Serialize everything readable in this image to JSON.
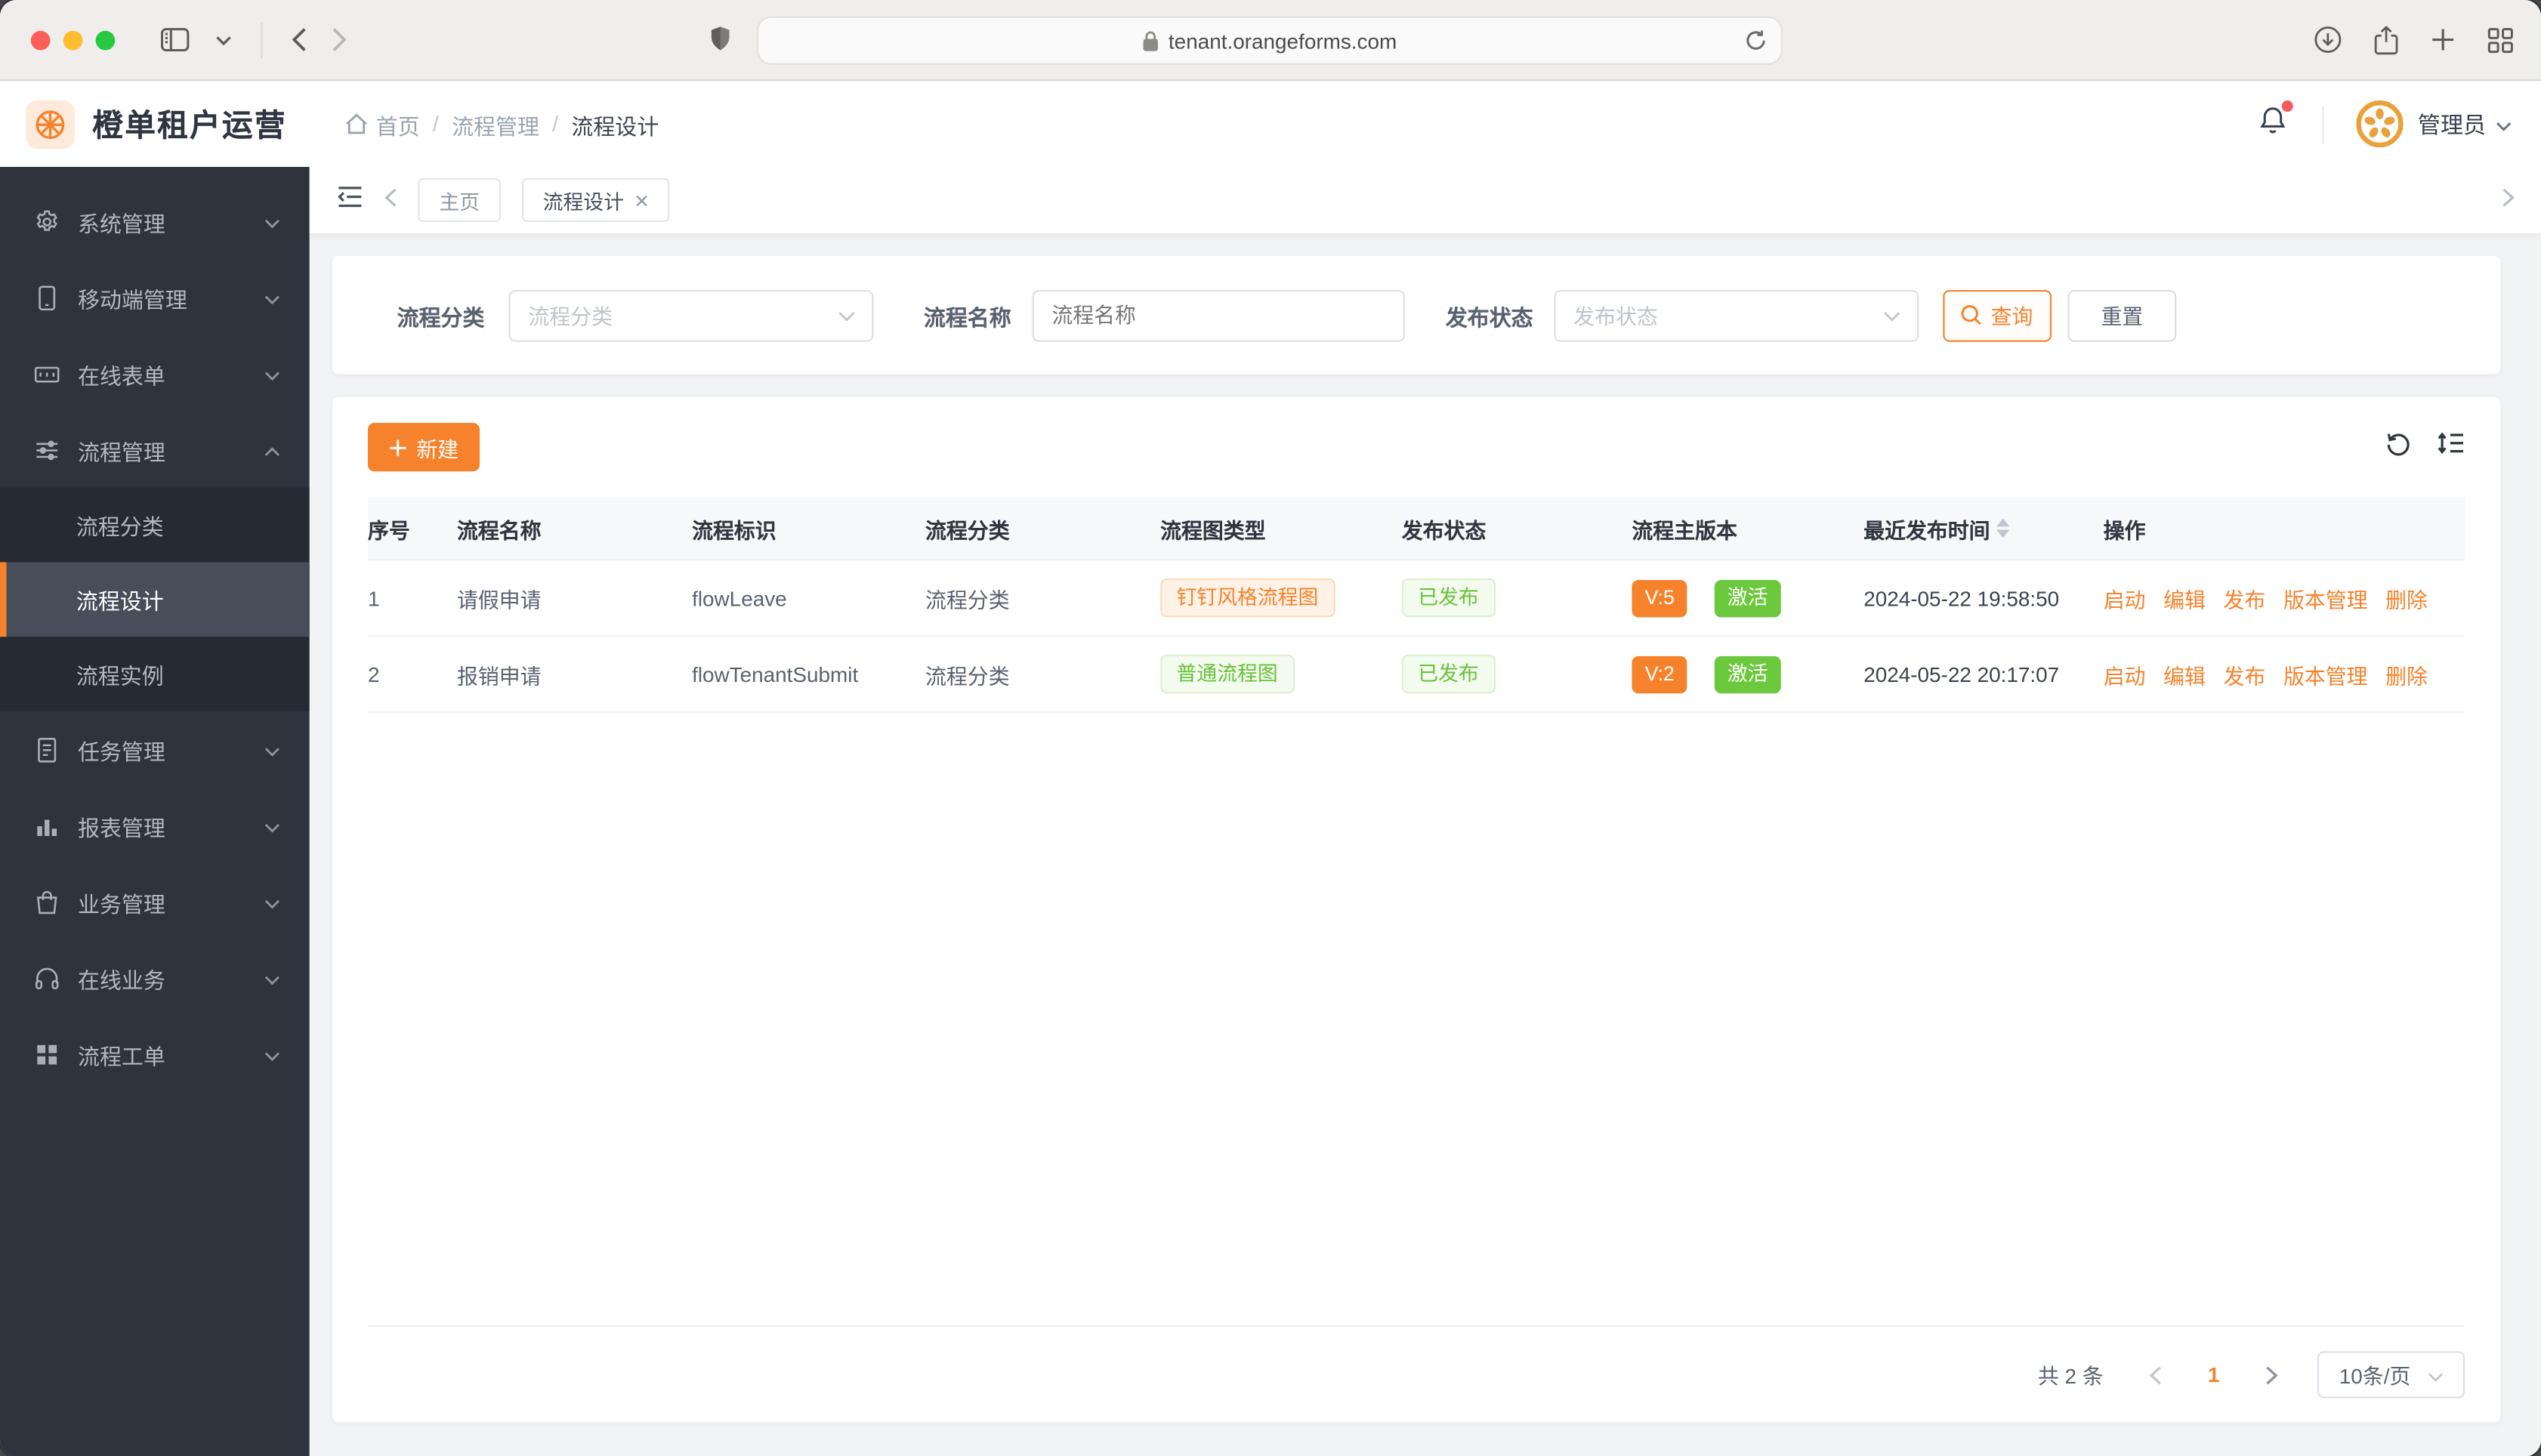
{
  "browser": {
    "url": "tenant.orangeforms.com"
  },
  "app_header": {
    "title": "橙单租户运营",
    "breadcrumb": {
      "home": "首页",
      "section": "流程管理",
      "current": "流程设计"
    },
    "user_name": "管理员"
  },
  "sidebar": {
    "items": [
      {
        "label": "系统管理"
      },
      {
        "label": "移动端管理"
      },
      {
        "label": "在线表单"
      },
      {
        "label": "流程管理",
        "children": [
          {
            "label": "流程分类"
          },
          {
            "label": "流程设计"
          },
          {
            "label": "流程实例"
          }
        ]
      },
      {
        "label": "任务管理"
      },
      {
        "label": "报表管理"
      },
      {
        "label": "业务管理"
      },
      {
        "label": "在线业务"
      },
      {
        "label": "流程工单"
      }
    ]
  },
  "tabs": {
    "items": [
      {
        "label": "主页"
      },
      {
        "label": "流程设计"
      }
    ]
  },
  "filters": {
    "category_label": "流程分类",
    "category_placeholder": "流程分类",
    "name_label": "流程名称",
    "name_placeholder": "流程名称",
    "status_label": "发布状态",
    "status_placeholder": "发布状态",
    "search": "查询",
    "reset": "重置"
  },
  "toolbar": {
    "create": "新建"
  },
  "table": {
    "columns": [
      "序号",
      "流程名称",
      "流程标识",
      "流程分类",
      "流程图类型",
      "发布状态",
      "流程主版本",
      "最近发布时间",
      "操作"
    ],
    "rows": [
      {
        "index": "1",
        "name": "请假申请",
        "key": "flowLeave",
        "category": "流程分类",
        "diagram_type": "钉钉风格流程图",
        "publish_status": "已发布",
        "version": "V:5",
        "active_status": "激活",
        "published_at": "2024-05-22 19:58:50",
        "actions": [
          "启动",
          "编辑",
          "发布",
          "版本管理",
          "删除"
        ]
      },
      {
        "index": "2",
        "name": "报销申请",
        "key": "flowTenantSubmit",
        "category": "流程分类",
        "diagram_type": "普通流程图",
        "publish_status": "已发布",
        "version": "V:2",
        "active_status": "激活",
        "published_at": "2024-05-22 20:17:07",
        "actions": [
          "启动",
          "编辑",
          "发布",
          "版本管理",
          "删除"
        ]
      }
    ]
  },
  "pagination": {
    "total": "共 2 条",
    "current_page": "1",
    "page_size": "10条/页"
  },
  "colors": {
    "primary_orange": "#f6822b",
    "success_green": "#6cc83c",
    "tag_green_text": "#67c23a",
    "sidebar_bg": "#2e333e",
    "notification_red": "#f25c5c"
  }
}
